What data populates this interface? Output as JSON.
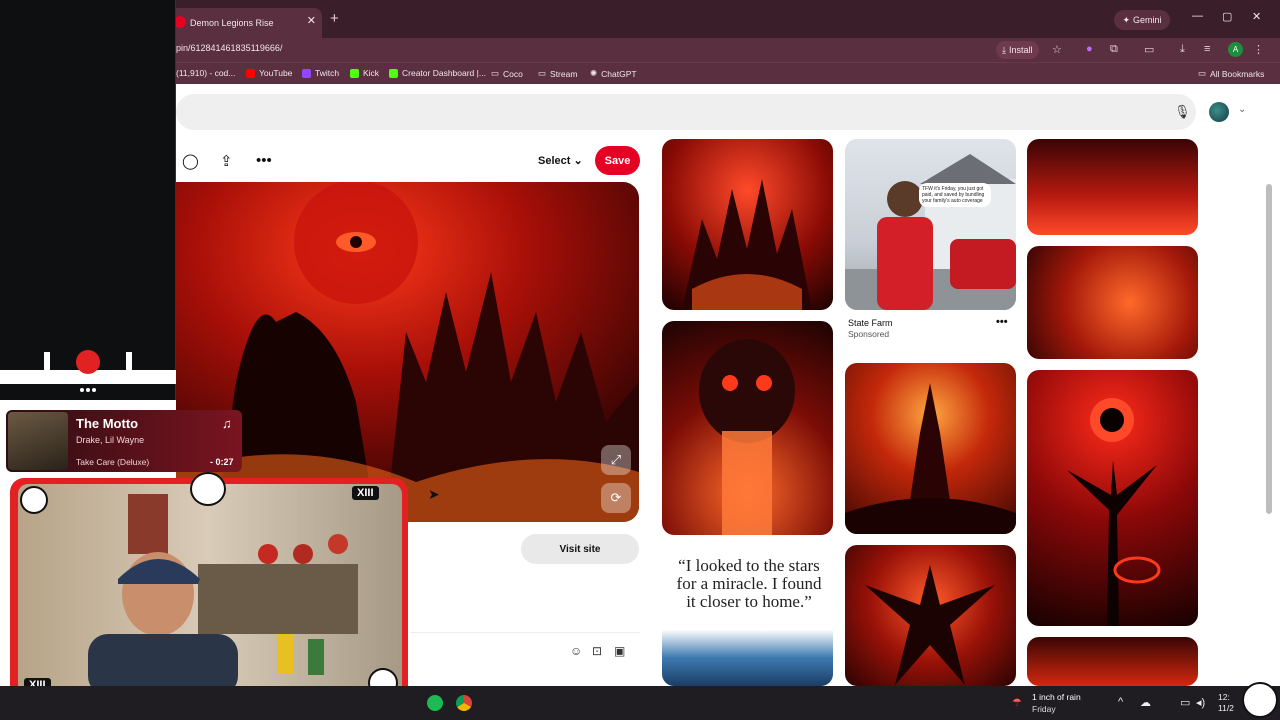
{
  "browser": {
    "tab_title": "Demon Legions Rise",
    "url": "pin/612841461835119666/",
    "install_label": "Install",
    "gemini_label": "Gemini",
    "profile_initial": "A",
    "bookmarks": [
      "(11,910) - cod...",
      "YouTube",
      "Twitch",
      "Kick",
      "Creator Dashboard |...",
      "Coco",
      "Stream",
      "ChatGPT"
    ],
    "all_bookmarks": "All Bookmarks"
  },
  "pin": {
    "select_label": "Select",
    "save_label": "Save",
    "visit_site": "Visit site"
  },
  "ad": {
    "advertiser": "State Farm",
    "sponsored": "Sponsored",
    "caption": "TFW it's Friday, you just got paid, and saved by bundling your family's auto coverage"
  },
  "quote_tile": {
    "text": "“I looked to the stars for a miracle. I found it closer to home.”"
  },
  "music": {
    "title": "The Motto",
    "artist": "Drake, Lil Wayne",
    "album": "Take Care (Deluxe)",
    "time": "- 0:27"
  },
  "overlay": {
    "badge": "XIII"
  },
  "taskbar": {
    "weather_line1": "1 inch of rain",
    "weather_line2": "Friday",
    "clock_time": "12:",
    "clock_date": "11/2"
  }
}
